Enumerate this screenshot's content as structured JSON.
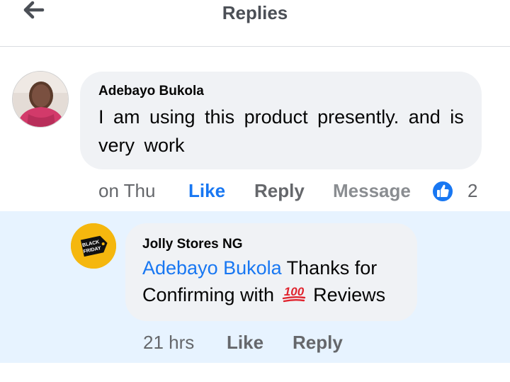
{
  "header": {
    "title": "Replies",
    "back_icon": "arrow-left-icon"
  },
  "comment": {
    "author": "Adebayo Bukola",
    "text": "I am  using  this  product  presently. and is very  work",
    "time": "on Thu",
    "like_label": "Like",
    "reply_label": "Reply",
    "message_label": "Message",
    "reaction_icon": "thumbs-up-icon",
    "reaction_count": "2"
  },
  "reply": {
    "author": "Jolly Stores NG",
    "avatar_text": [
      "BLACK",
      "FRIDAY"
    ],
    "mention": "Adebayo Bukola",
    "text_before_emoji": " Thanks for Confirming with ",
    "emoji_icon": "hundred-points-icon",
    "emoji_text": "100",
    "text_after_emoji": " Reviews",
    "time": "21 hrs",
    "like_label": "Like",
    "reply_label": "Reply"
  },
  "colors": {
    "link_blue": "#1877f2",
    "bubble_bg": "#f0f2f5",
    "highlight_bg": "#e7f3ff",
    "secondary_text": "#65676b"
  }
}
